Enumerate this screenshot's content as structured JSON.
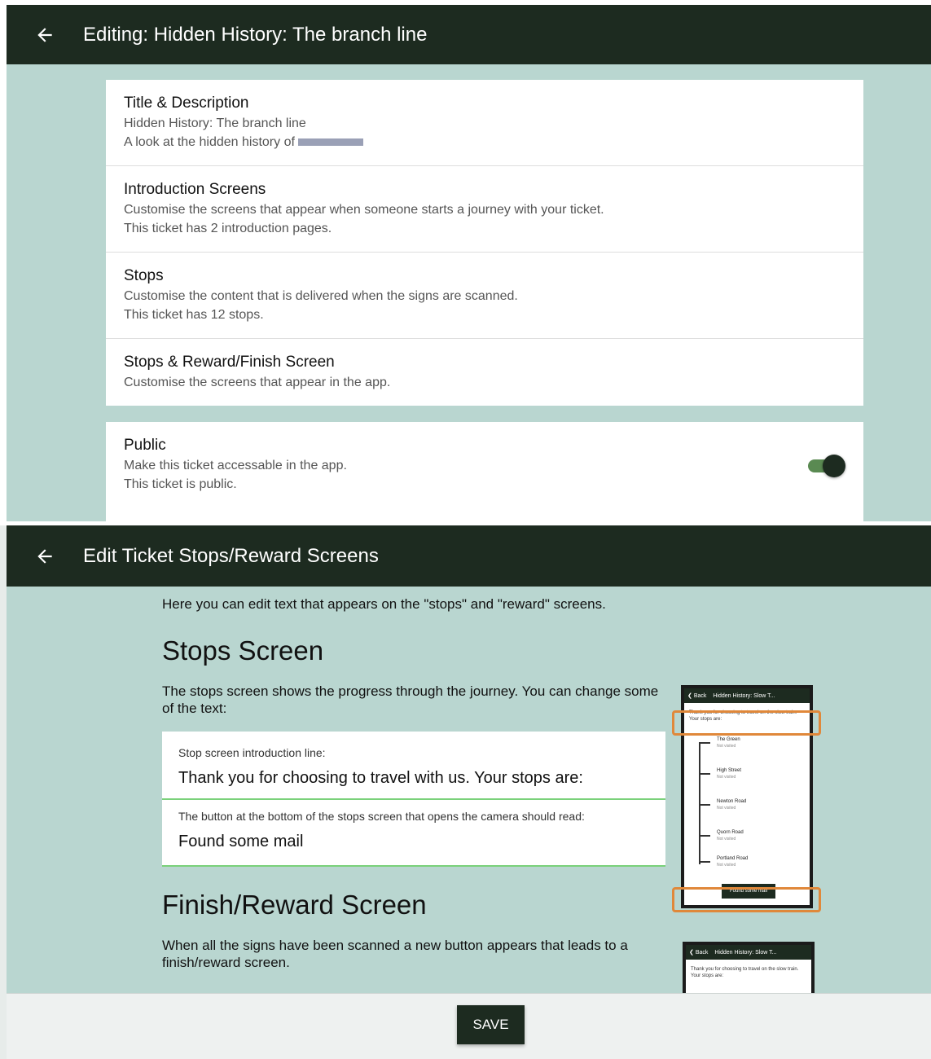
{
  "screen1": {
    "title": "Editing: Hidden History: The branch line",
    "items": [
      {
        "title": "Title & Description",
        "lines": [
          "Hidden History: The branch line",
          "A look at the hidden history of"
        ]
      },
      {
        "title": "Introduction Screens",
        "lines": [
          "Customise the screens that appear when someone starts a journey with your ticket.",
          "This ticket has 2 introduction pages."
        ]
      },
      {
        "title": "Stops",
        "lines": [
          "Customise the content that is delivered when the signs are scanned.",
          "This ticket has 12 stops."
        ]
      },
      {
        "title": "Stops & Reward/Finish Screen",
        "lines": [
          "Customise the screens that appear in the app."
        ]
      }
    ],
    "public": {
      "title": "Public",
      "lines": [
        "Make this ticket accessable in the app.",
        "This ticket is public."
      ],
      "enabled": true
    }
  },
  "screen2": {
    "title": "Edit Ticket Stops/Reward Screens",
    "intro": "Here you can edit text that appears on the \"stops\" and \"reward\" screens.",
    "stops_heading": "Stops Screen",
    "stops_para": "The stops screen shows the progress through the journey. You can change some of the text:",
    "fields": [
      {
        "label": "Stop screen introduction line:",
        "value": "Thank you for choosing to travel with us. Your stops are:"
      },
      {
        "label": "The button at the bottom of the stops screen that opens the camera should read:",
        "value": "Found some mail"
      }
    ],
    "finish_heading": "Finish/Reward Screen",
    "finish_para": "When all the signs have been scanned a new button appears that leads to a finish/reward screen.",
    "save_label": "SAVE"
  },
  "preview": {
    "back": "Back",
    "title": "Hidden History: Slow T...",
    "intro": "Thank you for choosing to travel on the slow train. Your stops are:",
    "stops": [
      {
        "name": "The Green",
        "status": "Not visited"
      },
      {
        "name": "High Street",
        "status": "Not visited"
      },
      {
        "name": "Newton Road",
        "status": "Not visited"
      },
      {
        "name": "Quorn Road",
        "status": "Not visited"
      },
      {
        "name": "Portland Road",
        "status": "Not visited"
      }
    ],
    "button": "Found some mail"
  },
  "colors": {
    "appbar": "#1d2b20",
    "background": "#b9d6d0",
    "accent": "#7ad17a",
    "highlight": "#e0883a",
    "toggle_track": "#5a8a52"
  }
}
